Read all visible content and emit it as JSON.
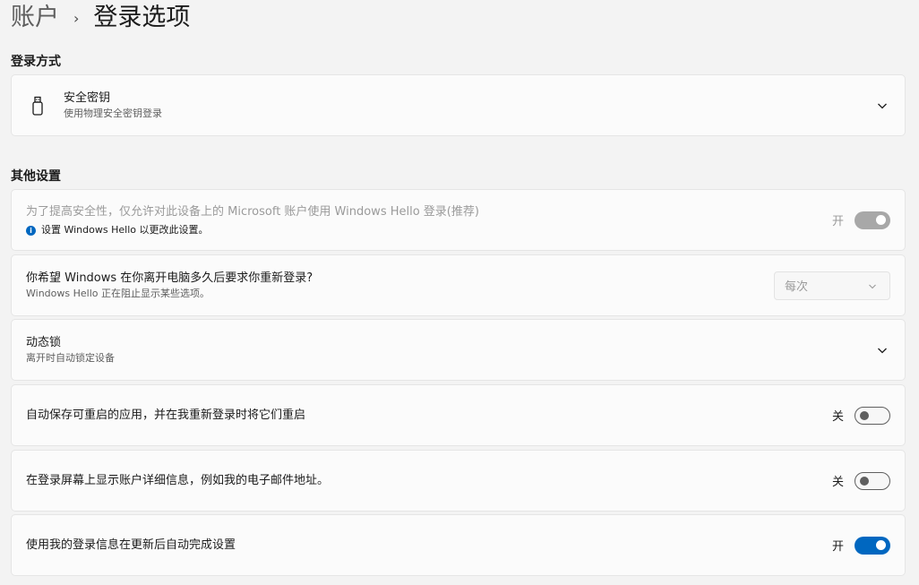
{
  "breadcrumb": {
    "parent": "账户",
    "separator": "›",
    "current": "登录选项"
  },
  "sections": {
    "signin_methods": "登录方式",
    "other_settings": "其他设置"
  },
  "security_key": {
    "title": "安全密钥",
    "subtitle": "使用物理安全密钥登录",
    "icon": "usb-key-icon"
  },
  "hello_only": {
    "title": "为了提高安全性，仅允许对此设备上的 Microsoft 账户使用 Windows Hello 登录(推荐)",
    "info": "设置 Windows Hello 以更改此设置。",
    "info_icon": "i",
    "state_label": "开",
    "state": "on-disabled"
  },
  "require_signin": {
    "title": "你希望 Windows 在你离开电脑多久后要求你重新登录?",
    "subtitle": "Windows Hello 正在阻止显示某些选项。",
    "selected": "每次"
  },
  "dynamic_lock": {
    "title": "动态锁",
    "subtitle": "离开时自动锁定设备"
  },
  "restart_apps": {
    "title": "自动保存可重启的应用，并在我重新登录时将它们重启",
    "state_label": "关",
    "state": "off"
  },
  "show_account": {
    "title": "在登录屏幕上显示账户详细信息，例如我的电子邮件地址。",
    "state_label": "关",
    "state": "off"
  },
  "auto_finish": {
    "title": "使用我的登录信息在更新后自动完成设置",
    "state_label": "开",
    "state": "on"
  },
  "colors": {
    "accent": "#0067c0",
    "background": "#f3f3f3",
    "card": "#fbfbfb"
  }
}
